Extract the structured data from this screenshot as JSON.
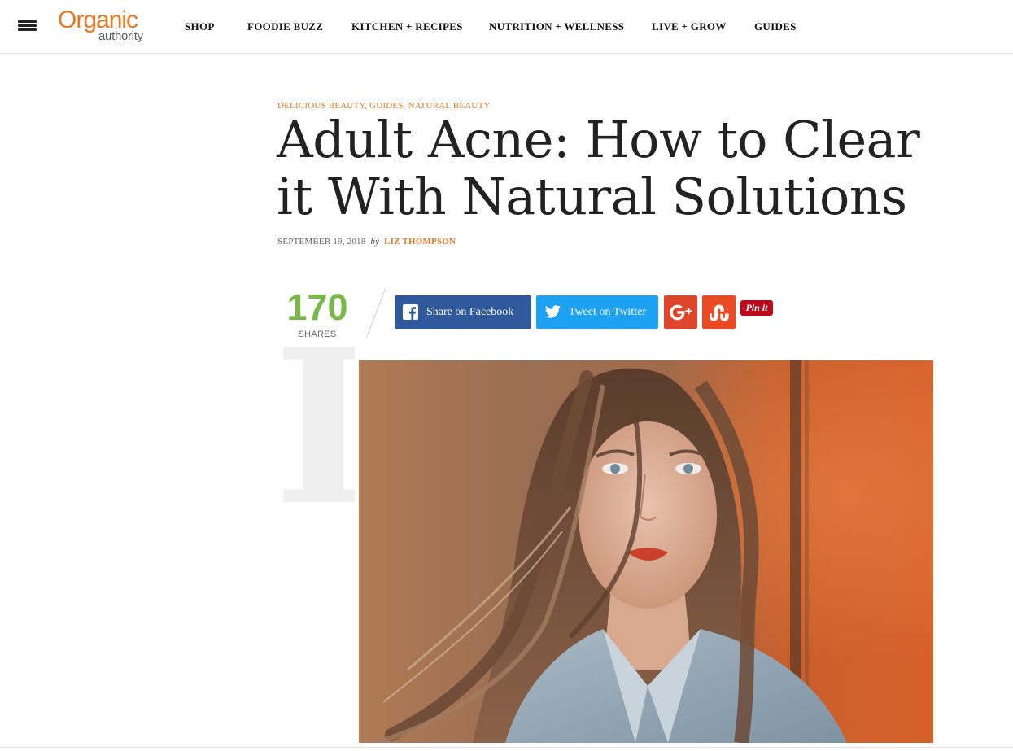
{
  "header": {
    "logo_top": "Organic",
    "logo_bottom": "authority",
    "nav": [
      {
        "label": "SHOP"
      },
      {
        "label": "FOODIE BUZZ"
      },
      {
        "label": "KITCHEN + RECIPES"
      },
      {
        "label": "NUTRITION + WELLNESS"
      },
      {
        "label": "LIVE + GROW"
      },
      {
        "label": "GUIDES"
      }
    ]
  },
  "article": {
    "categories": [
      "DELICIOUS BEAUTY",
      "GUIDES",
      "NATURAL BEAUTY"
    ],
    "title_line1": "Adult Acne: How to Clear",
    "title_line2": "it With Natural Solutions",
    "date": "SEPTEMBER 19, 2018",
    "by": "by",
    "author": "LIZ THOMPSON",
    "drop_cap": "I"
  },
  "share": {
    "count": "170",
    "count_label": "SHARES",
    "facebook_label": "Share on Facebook",
    "twitter_label": "Tweet on Twitter",
    "pinterest_label": "Pin it"
  },
  "icons": {
    "menu": "hamburger-menu-icon",
    "facebook": "facebook-icon",
    "twitter": "twitter-icon",
    "googleplus": "google-plus-icon",
    "stumbleupon": "stumbleupon-icon"
  },
  "colors": {
    "brand_orange": "#e87722",
    "share_count_green": "#7ab648",
    "facebook_blue": "#30599c",
    "twitter_blue": "#1da1f2",
    "googleplus_red": "#e0442b",
    "stumbleupon_orange": "#eb4924",
    "pinterest_red": "#bd081c"
  }
}
